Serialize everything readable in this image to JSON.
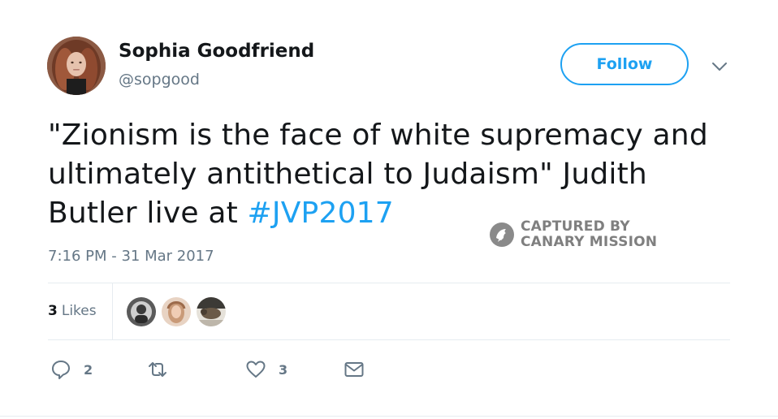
{
  "tweet": {
    "author": {
      "display_name": "Sophia Goodfriend",
      "handle": "@sopgood"
    },
    "follow_label": "Follow",
    "text_before": "\"Zionism is the face of white supremacy and ultimately antithetical to Judaism\" Judith Butler live at ",
    "hashtag": "#JVP2017",
    "timestamp": "7:16 PM - 31 Mar 2017",
    "likes_count": "3",
    "likes_label": "Likes",
    "actions": {
      "reply_count": "2",
      "retweet_count": "",
      "like_count": "3"
    }
  },
  "watermark": {
    "line1": "CAPTURED BY",
    "line2": "CANARY MISSION"
  },
  "icons": {
    "reply": "speech-bubble-icon",
    "retweet": "retweet-arrows-icon",
    "like": "heart-outline-icon",
    "dm": "envelope-icon",
    "menu": "chevron-down-icon"
  },
  "colors": {
    "accent": "#1da1f2",
    "text": "#14171a",
    "muted": "#657786",
    "divider": "#e6ecf0"
  }
}
